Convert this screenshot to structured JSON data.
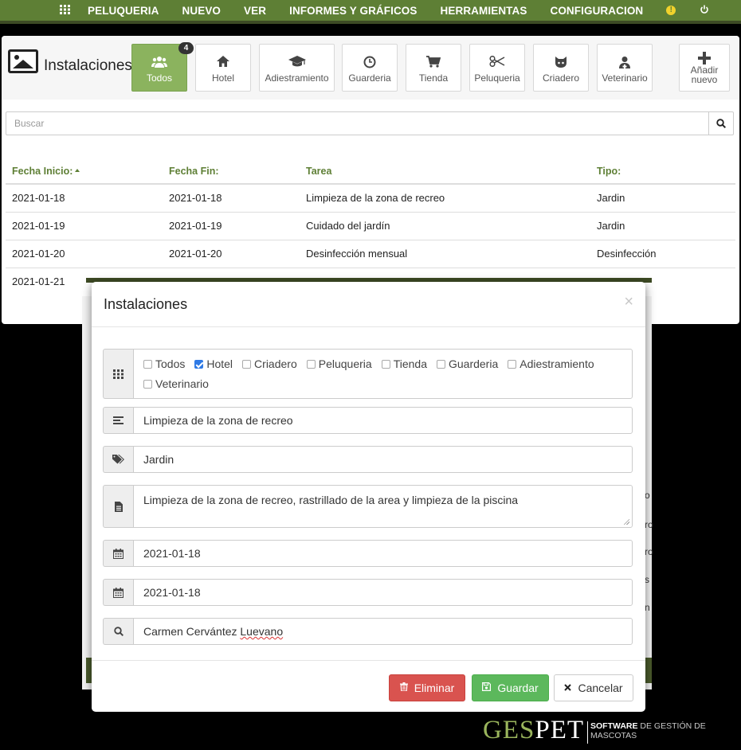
{
  "nav": {
    "items": [
      "PELUQUERIA",
      "NUEVO",
      "VER",
      "INFORMES Y GRÁFICOS",
      "HERRAMIENTAS",
      "CONFIGURACION"
    ],
    "icons": [
      "grid-icon",
      "warning-icon",
      "power-icon"
    ]
  },
  "panel": {
    "title": "Instalaciones",
    "categories": [
      {
        "label": "Todos",
        "icon": "users-icon",
        "active": true,
        "badge": "4"
      },
      {
        "label": "Hotel",
        "icon": "home-icon"
      },
      {
        "label": "Adiestramiento",
        "icon": "graduation-cap-icon"
      },
      {
        "label": "Guarderia",
        "icon": "clock-icon"
      },
      {
        "label": "Tienda",
        "icon": "cart-icon"
      },
      {
        "label": "Peluqueria",
        "icon": "scissors-icon"
      },
      {
        "label": "Criadero",
        "icon": "cat-icon"
      },
      {
        "label": "Veterinario",
        "icon": "user-md-icon"
      }
    ],
    "add_label_line1": "Añadir",
    "add_label_line2": "nuevo",
    "search_placeholder": "Buscar"
  },
  "table": {
    "headers": [
      "Fecha Inicio:",
      "Fecha Fin:",
      "Tarea",
      "Tipo:"
    ],
    "rows": [
      [
        "2021-01-18",
        "2021-01-18",
        "Limpieza de la zona de recreo",
        "Jardin"
      ],
      [
        "2021-01-19",
        "2021-01-19",
        "Cuidado del jardín",
        "Jardin"
      ],
      [
        "2021-01-20",
        "2021-01-20",
        "Desinfección mensual",
        "Desinfección"
      ],
      [
        "2021-01-21",
        "",
        "",
        ""
      ]
    ]
  },
  "modal": {
    "title": "Instalaciones",
    "close": "×",
    "checkboxes": [
      {
        "label": "Todos",
        "checked": false
      },
      {
        "label": "Hotel",
        "checked": true
      },
      {
        "label": "Criadero",
        "checked": false
      },
      {
        "label": "Peluqueria",
        "checked": false
      },
      {
        "label": "Tienda",
        "checked": false
      },
      {
        "label": "Guarderia",
        "checked": false
      },
      {
        "label": "Adiestramiento",
        "checked": false
      },
      {
        "label": "Veterinario",
        "checked": false
      }
    ],
    "task": "Limpieza de la zona de recreo",
    "type": "Jardin",
    "description": "Limpieza de la zona de recreo, rastrillado de la area y limpieza de la piscina",
    "start_date": "2021-01-18",
    "end_date": "2021-01-18",
    "person_first": "Carmen Cervántez ",
    "person_last": "Luevano",
    "buttons": {
      "delete": "Eliminar",
      "save": "Guardar",
      "cancel": "Cancelar"
    }
  },
  "behind_peek": [
    "o",
    "ro",
    "ro",
    "s",
    "n"
  ],
  "brand": {
    "ges": "GES",
    "pet": "PET",
    "software": "SOFTWARE",
    "rest": " DE GESTIÓN DE MASCOTAS"
  },
  "colors": {
    "nav": "#5e7f35",
    "active": "#8bb35e",
    "header_text": "#5e7f35",
    "danger": "#d9534f",
    "success": "#5cb85c"
  }
}
